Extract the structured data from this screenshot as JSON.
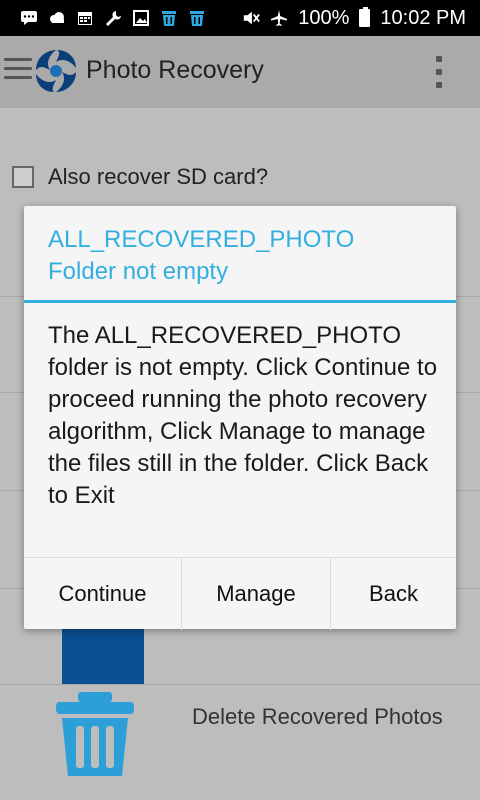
{
  "status_bar": {
    "icons": [
      "message-icon",
      "cloud-icon",
      "calendar-icon",
      "wrench-icon",
      "image-icon",
      "trash-icon",
      "trash-icon",
      "mute-icon",
      "airplane-icon"
    ],
    "battery": "100%",
    "time": "10:02 PM"
  },
  "app_bar": {
    "title": "Photo Recovery"
  },
  "background": {
    "sd_label": "Also recover SD card?",
    "delete_label": "Delete Recovered Photos"
  },
  "dialog": {
    "title_line1": "ALL_RECOVERED_PHOTO",
    "title_line2": "Folder not empty",
    "message": "The ALL_RECOVERED_PHOTO folder is not empty. Click Continue to proceed running the photo recovery algorithm, Click Manage to manage the files still in the folder. Click Back to Exit",
    "buttons": {
      "continue": "Continue",
      "manage": "Manage",
      "back": "Back"
    }
  },
  "colors": {
    "accent": "#32aee0",
    "app_bar": "#aaaaaa",
    "dim_background": "#bdbdbd",
    "icon_dark_blue": "#0a4f8f"
  }
}
